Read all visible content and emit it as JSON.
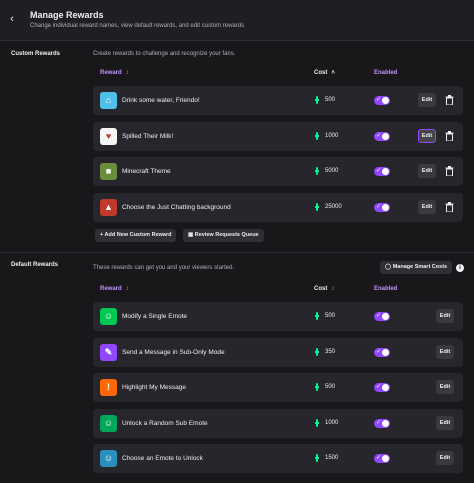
{
  "header": {
    "title": "Manage Rewards",
    "subtitle": "Change individual reward names, view default rewards, and edit custom rewards"
  },
  "custom": {
    "label": "Custom Rewards",
    "description": "Create rewards to challenge and recognize your fans.",
    "columns": {
      "reward": "Reward",
      "cost": "Cost",
      "enabled": "Enabled"
    },
    "rows": [
      {
        "name": "Drink some water, Friendo!",
        "cost": "500",
        "icon": "water-icon",
        "color": "#4fc1e9",
        "enabled": true,
        "edit": "Edit"
      },
      {
        "name": "Spilled Their Milk!",
        "cost": "1000",
        "icon": "milk-icon",
        "color": "#f5f5f5",
        "enabled": true,
        "edit": "Edit"
      },
      {
        "name": "Minecraft Theme",
        "cost": "5000",
        "icon": "minecraft-icon",
        "color": "#6b8e3d",
        "enabled": true,
        "edit": "Edit"
      },
      {
        "name": "Choose the Just Chatting background",
        "cost": "25000",
        "icon": "background-icon",
        "color": "#c0392b",
        "enabled": true,
        "edit": "Edit"
      }
    ],
    "add_button": "Add New Custom Reward",
    "queue_button": "Review Requests Queue"
  },
  "default": {
    "label": "Default Rewards",
    "description": "These rewards can get you and your viewers started.",
    "smart_costs_button": "Manage Smart Costs",
    "columns": {
      "reward": "Reward",
      "cost": "Cost",
      "enabled": "Enabled"
    },
    "rows": [
      {
        "name": "Modify a Single Emote",
        "cost": "500",
        "icon": "emote-modify-icon",
        "color": "#00c853",
        "enabled": true,
        "edit": "Edit"
      },
      {
        "name": "Send a Message in Sub-Only Mode",
        "cost": "350",
        "icon": "pencil-icon",
        "color": "#9147ff",
        "enabled": true,
        "edit": "Edit"
      },
      {
        "name": "Highlight My Message",
        "cost": "500",
        "icon": "highlight-icon",
        "color": "#ff6905",
        "enabled": true,
        "edit": "Edit"
      },
      {
        "name": "Unlock a Random Sub Emote",
        "cost": "1000",
        "icon": "random-emote-icon",
        "color": "#00a65a",
        "enabled": true,
        "edit": "Edit"
      },
      {
        "name": "Choose an Emote to Unlock",
        "cost": "1500",
        "icon": "choose-emote-icon",
        "color": "#2a8fbd",
        "enabled": true,
        "edit": "Edit"
      }
    ]
  },
  "colors": {
    "accent": "#9147ff",
    "points": "#00f593",
    "background": "#18181b",
    "row": "#26262c"
  }
}
